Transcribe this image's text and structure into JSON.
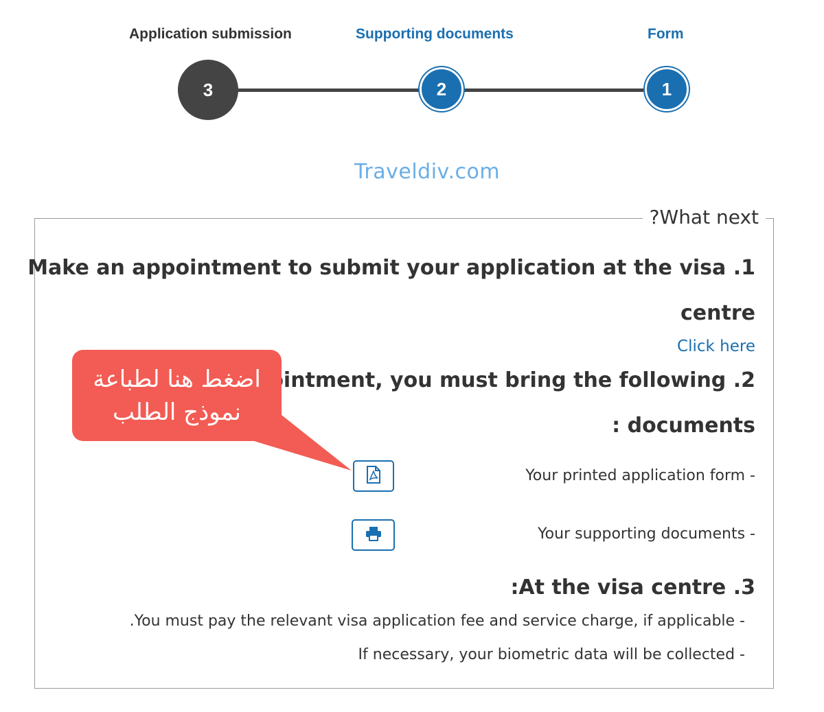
{
  "stepper": {
    "steps": [
      {
        "label": "Application submission",
        "number": "3",
        "state": "current"
      },
      {
        "label": "Supporting documents",
        "number": "2",
        "state": "completed"
      },
      {
        "label": "Form",
        "number": "1",
        "state": "completed"
      }
    ]
  },
  "watermark": "Traveldiv.com",
  "panel": {
    "legend": "?What next",
    "section1": {
      "heading_line1": "Make an appointment to submit your application at the visa .1",
      "heading_line2": "centre",
      "link": "Click here"
    },
    "section2": {
      "heading_line1": "r appointment, you must bring the following .2",
      "heading_line2": ": documents",
      "items": [
        {
          "text": "Your printed application form -",
          "icon": "pdf-icon"
        },
        {
          "text": "Your supporting documents -",
          "icon": "print-icon"
        }
      ]
    },
    "section3": {
      "heading": ":At the visa centre .3",
      "items": [
        ".You must pay the relevant visa application fee and service charge, if applicable -",
        "If necessary, your biometric data will be collected -"
      ]
    }
  },
  "callout": {
    "line1": "اضغط هنا لطباعة",
    "line2": "نموذج الطلب"
  },
  "colors": {
    "accent": "#1a6fb0",
    "step_done": "#444444",
    "callout": "#f25c54",
    "watermark": "#6aaee6"
  }
}
